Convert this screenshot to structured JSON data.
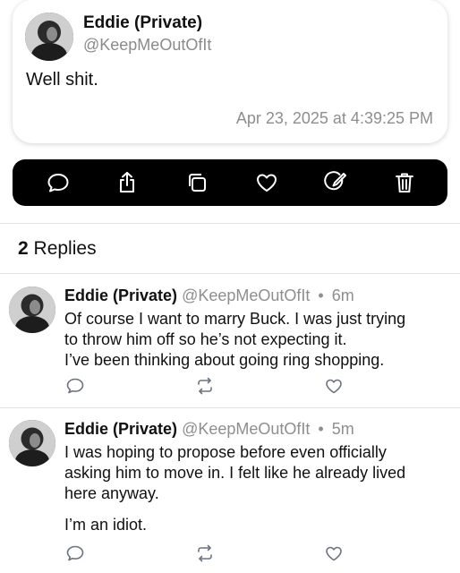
{
  "post": {
    "author_name": "Eddie (Private)",
    "author_handle": "@KeepMeOutOfIt",
    "text": "Well shit.",
    "timestamp": "Apr 23, 2025 at 4:39:25 PM"
  },
  "actions": [
    "reply-icon",
    "share-icon",
    "copy-icon",
    "heart-icon",
    "edit-icon",
    "trash-icon"
  ],
  "replies_header": {
    "count": "2",
    "label": "Replies"
  },
  "replies": [
    {
      "author_name": "Eddie (Private)",
      "author_handle": "@KeepMeOutOfIt",
      "separator": "•",
      "time": "6m",
      "lines": [
        "Of course I want to marry Buck. I was just trying",
        "to throw him off so he’s not expecting it.",
        "I’ve been thinking about going ring shopping."
      ]
    },
    {
      "author_name": "Eddie (Private)",
      "author_handle": "@KeepMeOutOfIt",
      "separator": "•",
      "time": "5m",
      "lines": [
        "I was hoping to propose before even officially",
        "asking him to move in. I felt like he already lived",
        "here anyway."
      ],
      "extra": "I’m an idiot."
    }
  ],
  "colors": {
    "action_bar_bg": "#000000",
    "icon_white": "#ffffff",
    "secondary_text": "#8e8e8e",
    "reply_icon_gray": "#6b7280"
  }
}
